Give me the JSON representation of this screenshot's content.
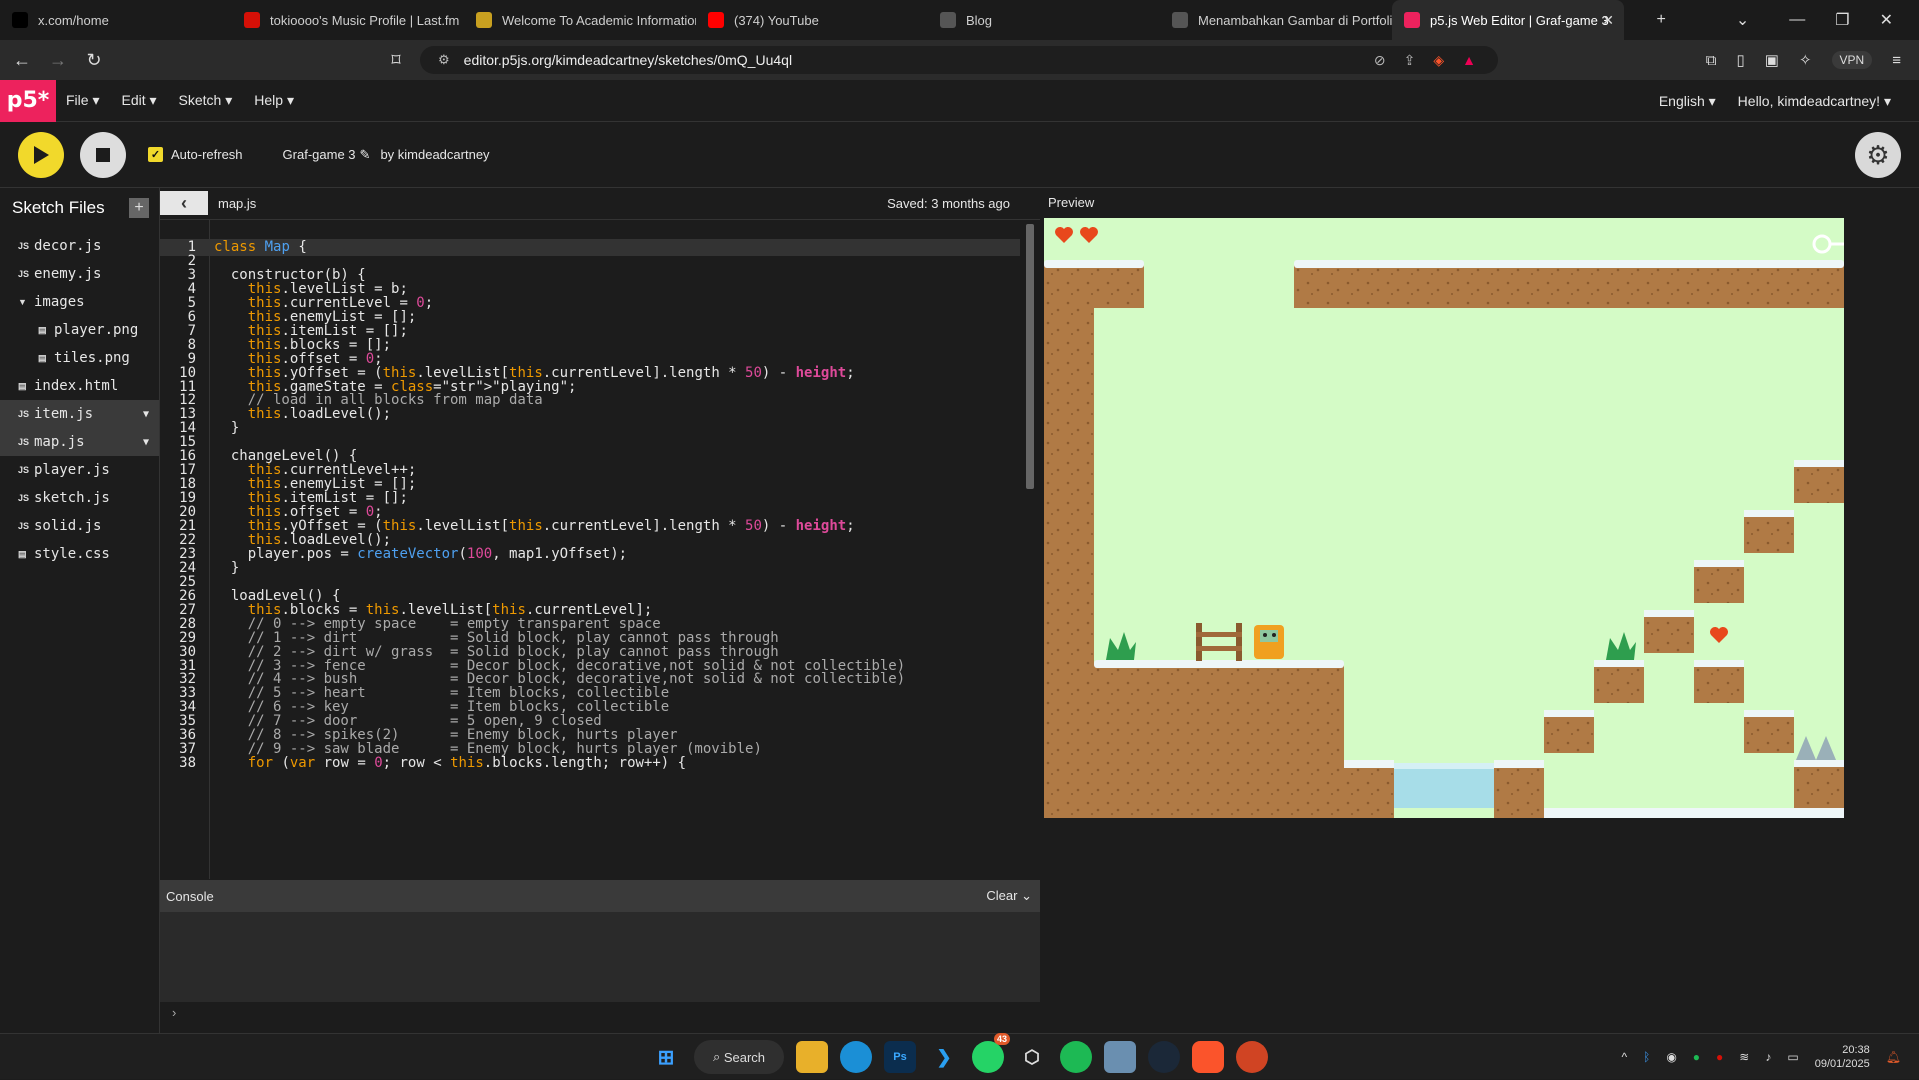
{
  "browser": {
    "tabs": [
      {
        "title": "x.com/home",
        "icon": "x-logo-icon",
        "color": "#000000"
      },
      {
        "title": "tokioooo's Music Profile | Last.fm",
        "icon": "lastfm-icon",
        "color": "#d51007"
      },
      {
        "title": "Welcome To Academic Information",
        "icon": "academic-icon",
        "color": "#c8a020"
      },
      {
        "title": "(374) YouTube",
        "icon": "youtube-icon",
        "color": "#ff0000"
      },
      {
        "title": "Blog",
        "icon": "globe-icon",
        "color": "#555555"
      },
      {
        "title": "Menambahkan Gambar di Portfolio",
        "icon": "globe-icon",
        "color": "#555555"
      },
      {
        "title": "p5.js Web Editor | Graf-game 3",
        "icon": "p5-icon",
        "color": "#ed225d"
      }
    ],
    "url": "editor.p5js.org/kimdeadcartney/sketches/0mQ_Uu4ql",
    "vpn_label": "VPN"
  },
  "p5": {
    "logo": "p5*",
    "menus": [
      "File",
      "Edit",
      "Sketch",
      "Help"
    ],
    "language": "English",
    "greeting": "Hello, kimdeadcartney!",
    "auto_refresh": "Auto-refresh",
    "sketch_name": "Graf-game 3",
    "by": "by kimdeadcartney",
    "sketch_files_title": "Sketch Files",
    "files": [
      {
        "name": "decor.js",
        "type": "JS",
        "indent": 0
      },
      {
        "name": "enemy.js",
        "type": "JS",
        "indent": 0
      },
      {
        "name": "images",
        "type": "folder",
        "indent": 0
      },
      {
        "name": "player.png",
        "type": "img",
        "indent": 1
      },
      {
        "name": "tiles.png",
        "type": "img",
        "indent": 1
      },
      {
        "name": "index.html",
        "type": "html",
        "indent": 0
      },
      {
        "name": "item.js",
        "type": "JS",
        "indent": 0,
        "selected": true
      },
      {
        "name": "map.js",
        "type": "JS",
        "indent": 0,
        "selected": true
      },
      {
        "name": "player.js",
        "type": "JS",
        "indent": 0
      },
      {
        "name": "sketch.js",
        "type": "JS",
        "indent": 0
      },
      {
        "name": "solid.js",
        "type": "JS",
        "indent": 0
      },
      {
        "name": "style.css",
        "type": "css",
        "indent": 0
      }
    ],
    "current_file": "map.js",
    "saved": "Saved: 3 months ago",
    "preview_label": "Preview",
    "console_label": "Console",
    "clear_label": "Clear"
  },
  "code_lines": [
    "class Map {",
    "",
    "  constructor(b) {",
    "    this.levelList = b;",
    "    this.currentLevel = 0;",
    "    this.enemyList = [];",
    "    this.itemList = [];",
    "    this.blocks = [];",
    "    this.offset = 0;",
    "    this.yOffset = (this.levelList[this.currentLevel].length * 50) - height;",
    "    this.gameState = \"playing\";",
    "    // load in all blocks from map data",
    "    this.loadLevel();",
    "  }",
    "",
    "  changeLevel() {",
    "    this.currentLevel++;",
    "    this.enemyList = [];",
    "    this.itemList = [];",
    "    this.offset = 0;",
    "    this.yOffset = (this.levelList[this.currentLevel].length * 50) - height;",
    "    this.loadLevel();",
    "    player.pos = createVector(100, map1.yOffset);",
    "  }",
    "",
    "  loadLevel() {",
    "    this.blocks = this.levelList[this.currentLevel];",
    "    // 0 --> empty space    = empty transparent space",
    "    // 1 --> dirt           = Solid block, play cannot pass through",
    "    // 2 --> dirt w/ grass  = Solid block, play cannot pass through",
    "    // 3 --> fence          = Decor block, decorative,not solid & not collectible)",
    "    // 4 --> bush           = Decor block, decorative,not solid & not collectible)",
    "    // 5 --> heart          = Item blocks, collectible",
    "    // 6 --> key            = Item blocks, collectible",
    "    // 7 --> door           = 5 open, 9 closed",
    "    // 8 --> spikes(2)      = Enemy block, hurts player",
    "    // 9 --> saw blade      = Enemy block, hurts player (movible)",
    "    for (var row = 0; row < this.blocks.length; row++) {"
  ],
  "taskbar": {
    "search_label": "Search",
    "time": "20:38",
    "date": "09/01/2025",
    "whatsapp_badge": "43"
  }
}
